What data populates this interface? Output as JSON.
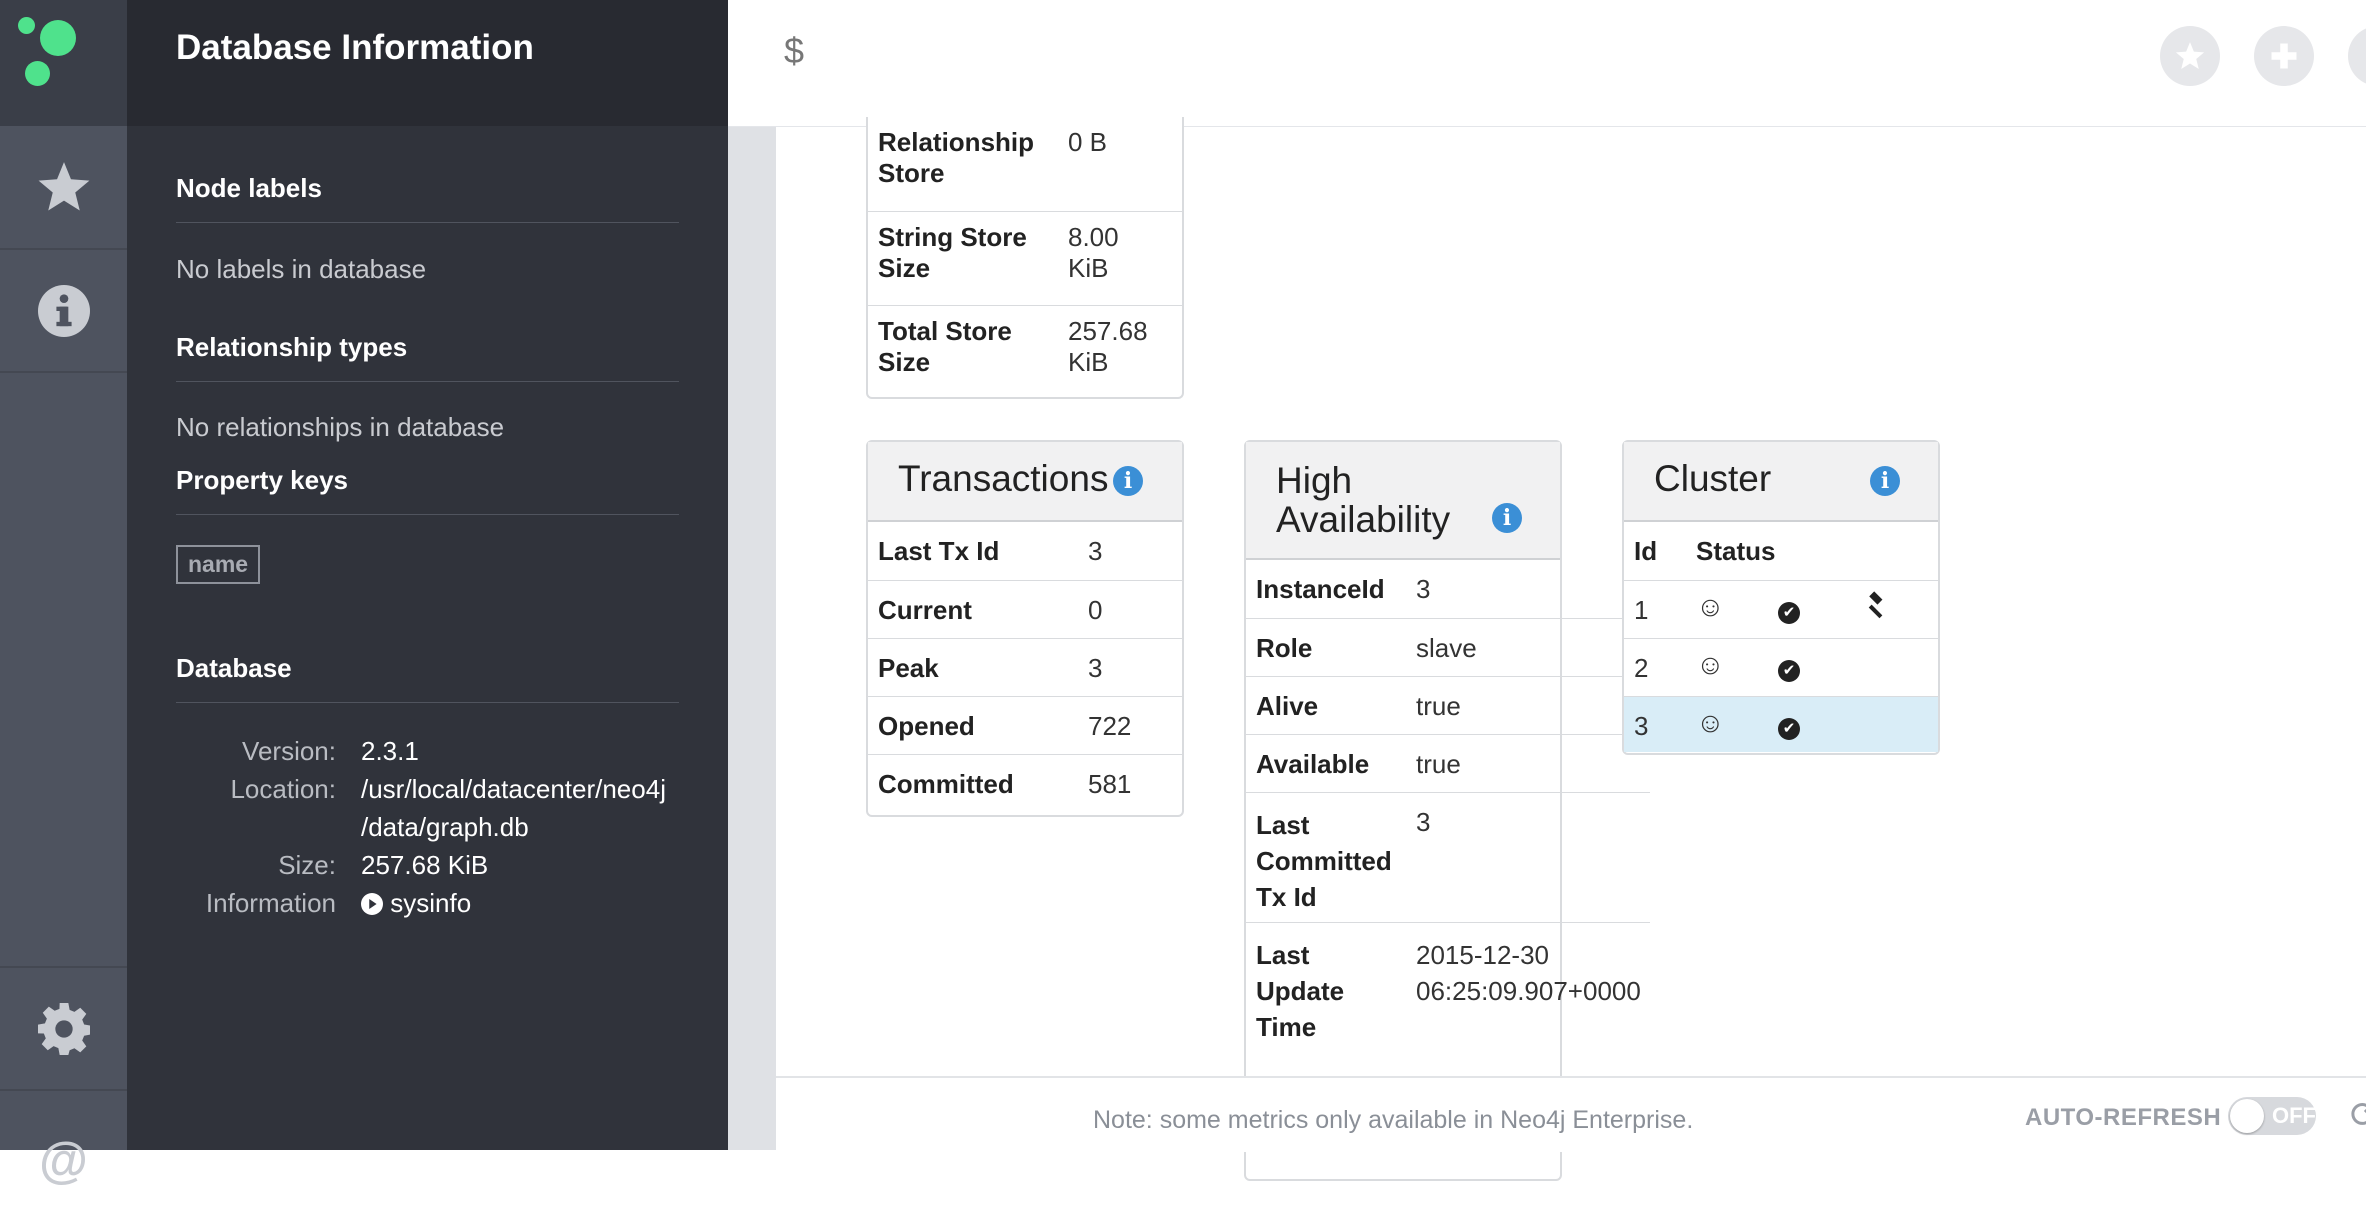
{
  "drawer": {
    "title": "Database Information",
    "node_labels_title": "Node labels",
    "node_labels_empty": "No labels in database",
    "rel_types_title": "Relationship types",
    "rel_types_empty": "No relationships in database",
    "property_keys_title": "Property keys",
    "property_keys": [
      "name"
    ],
    "database_title": "Database",
    "database": {
      "version_label": "Version:",
      "version": "2.3.1",
      "location_label": "Location:",
      "location_line1": "/usr/local/datacenter/neo4j",
      "location_line2": "/data/graph.db",
      "size_label": "Size:",
      "size": "257.68 KiB",
      "info_label": "Information",
      "info_link": "sysinfo"
    }
  },
  "header": {
    "prompt": "$"
  },
  "stores": {
    "rows": [
      {
        "k1": "Relationship",
        "k2": "Store",
        "v1": "0 B",
        "v2": ""
      },
      {
        "k1": "String Store",
        "k2": "Size",
        "v1": "8.00",
        "v2": "KiB"
      },
      {
        "k1": "Total Store",
        "k2": "Size",
        "v1": "257.68",
        "v2": "KiB"
      }
    ]
  },
  "transactions": {
    "title": "Transactions",
    "rows": [
      {
        "k": "Last Tx Id",
        "v": "3"
      },
      {
        "k": "Current",
        "v": "0"
      },
      {
        "k": "Peak",
        "v": "3"
      },
      {
        "k": "Opened",
        "v": "722"
      },
      {
        "k": "Committed",
        "v": "581"
      }
    ]
  },
  "ha": {
    "title_line1": "High",
    "title_line2": "Availability",
    "rows": [
      {
        "k": "InstanceId",
        "v": "3"
      },
      {
        "k": "Role",
        "v": "slave"
      },
      {
        "k": "Alive",
        "v": "true"
      },
      {
        "k": "Available",
        "v": "true"
      },
      {
        "k1": "Last",
        "k2": "Committed",
        "k3": "Tx Id",
        "v": "3"
      },
      {
        "k1": "Last",
        "k2": "Update",
        "k3": "Time",
        "v1": "2015-12-30",
        "v2": "06:25:09.907+0000"
      }
    ]
  },
  "cluster": {
    "title": "Cluster",
    "col_id": "Id",
    "col_status": "Status",
    "rows": [
      {
        "id": "1",
        "alive": "☺",
        "available": "✔",
        "master": "true"
      },
      {
        "id": "2",
        "alive": "☺",
        "available": "✔",
        "master": "false"
      },
      {
        "id": "3",
        "alive": "☺",
        "available": "✔",
        "master": "false",
        "current": "true"
      }
    ]
  },
  "footer": {
    "note": "Note: some metrics only available in Neo4j Enterprise.",
    "auto_refresh_label": "AUTO-REFRESH",
    "toggle_label": "OFF"
  },
  "colors": {
    "accent_green": "#4fe28c",
    "info_blue": "#3b8fd6",
    "highlight_row": "#d9edf7"
  }
}
